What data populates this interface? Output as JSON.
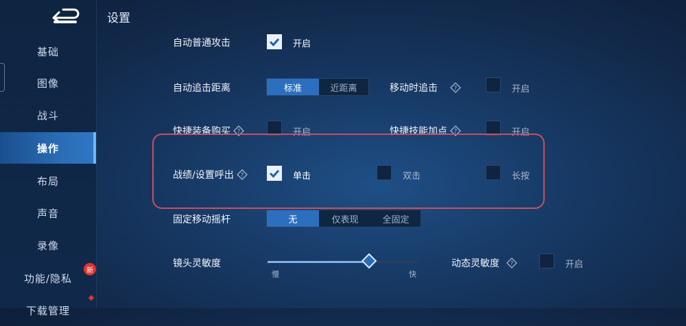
{
  "page": {
    "title": "设置"
  },
  "sidebar": {
    "items": [
      {
        "label": "基础",
        "active": false
      },
      {
        "label": "图像",
        "active": false
      },
      {
        "label": "战斗",
        "active": false
      },
      {
        "label": "操作",
        "active": true
      },
      {
        "label": "布局",
        "active": false
      },
      {
        "label": "声音",
        "active": false
      },
      {
        "label": "录像",
        "active": false
      },
      {
        "label": "功能/隐私",
        "active": false
      },
      {
        "label": "下载管理",
        "active": false
      }
    ],
    "new_badge": "新"
  },
  "settings": {
    "auto_attack": {
      "label": "自动普通攻击",
      "on_label": "开启",
      "checked": true
    },
    "auto_chase": {
      "label": "自动追击距离",
      "options": [
        "标准",
        "近距离"
      ],
      "selected": "标准"
    },
    "move_chase": {
      "label": "移动时追击",
      "on_label": "开启",
      "checked": false
    },
    "quick_buy": {
      "label": "快捷装备购买",
      "on_label": "开启",
      "checked": false
    },
    "quick_skill": {
      "label": "快捷技能加点",
      "on_label": "开启",
      "checked": false
    },
    "stats_call": {
      "label": "战绩/设置呼出",
      "options": [
        {
          "label": "单击",
          "checked": true
        },
        {
          "label": "双击",
          "checked": false
        },
        {
          "label": "长按",
          "checked": false
        }
      ]
    },
    "fixed_joystick": {
      "label": "固定移动摇杆",
      "options": [
        "无",
        "仅表现",
        "全固定"
      ],
      "selected": "无"
    },
    "camera_sens": {
      "label": "镜头灵敏度",
      "min_label": "慢",
      "max_label": "快",
      "value": 0.68
    },
    "dynamic_sens": {
      "label": "动态灵敏度",
      "on_label": "开启",
      "checked": false
    }
  },
  "colors": {
    "accent": "#2c6fbf",
    "highlight": "#c9505f",
    "badge": "#e2342f"
  }
}
